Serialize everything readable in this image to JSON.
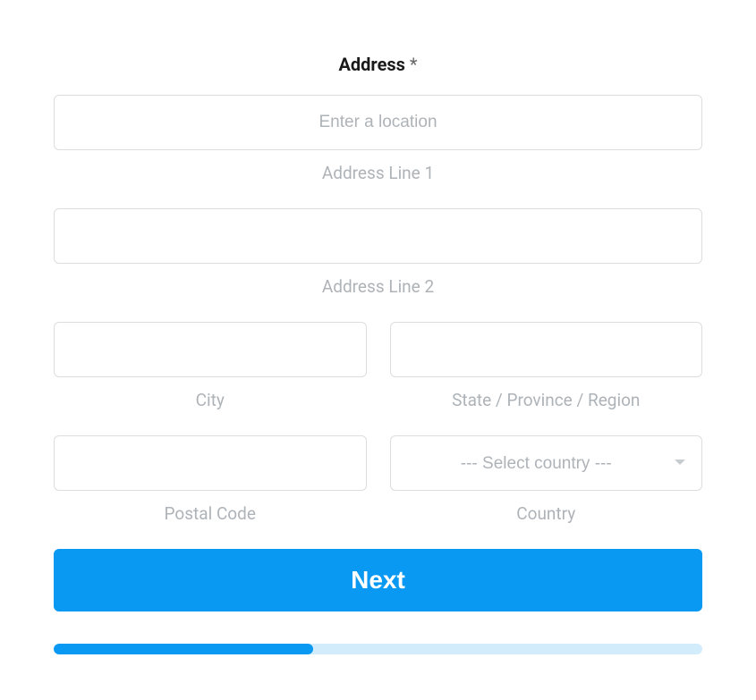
{
  "form": {
    "title": "Address",
    "required_mark": "*",
    "address_line_1": {
      "placeholder": "Enter a location",
      "value": "",
      "label": "Address Line 1"
    },
    "address_line_2": {
      "value": "",
      "label": "Address Line 2"
    },
    "city": {
      "value": "",
      "label": "City"
    },
    "state": {
      "value": "",
      "label": "State / Province / Region"
    },
    "postal_code": {
      "value": "",
      "label": "Postal Code"
    },
    "country": {
      "placeholder": "--- Select country ---",
      "value": "",
      "label": "Country"
    },
    "next_button": "Next",
    "progress_percent": 40
  }
}
